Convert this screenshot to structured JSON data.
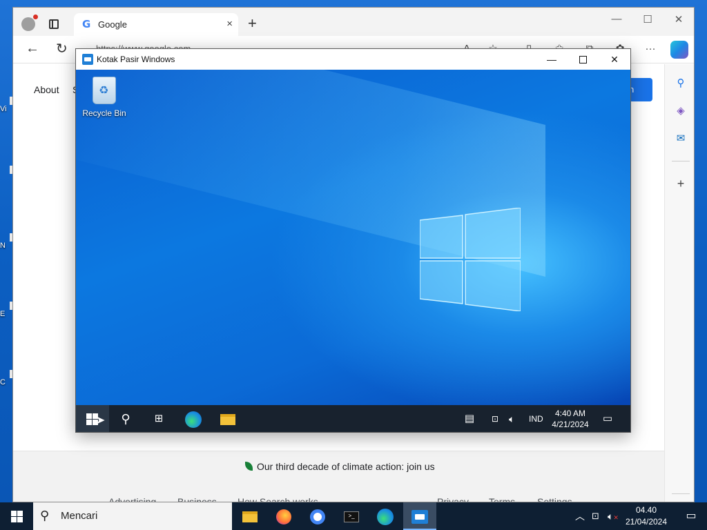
{
  "browser": {
    "tab": {
      "title": "Google",
      "close": "×"
    },
    "new_tab": "+",
    "window_controls": {
      "minimize": "—",
      "maximize": "☐",
      "close": "✕"
    },
    "url": "https://www.google.com",
    "icons": [
      "back-icon",
      "reload-icon",
      "read-aloud-icon",
      "favorite-star-icon",
      "split-screen-icon",
      "favorites-icon",
      "collections-icon",
      "extensions-icon",
      "more-icon",
      "copilot-icon"
    ],
    "more": "···",
    "sidebar": [
      "search-icon",
      "copilot-icon",
      "outlook-icon",
      "add-icon",
      "settings-icon"
    ]
  },
  "google_page": {
    "about": "About",
    "store_partial": "S",
    "sign_in_partial": "n",
    "climate": "Our third decade of climate action: join us",
    "footer_links": [
      "Advertising",
      "Business",
      "How Search works",
      "Privacy",
      "Terms",
      "Settings"
    ]
  },
  "sandbox": {
    "title": "Kotak Pasir Windows",
    "controls": {
      "minimize": "—",
      "close": "✕"
    },
    "recycle_bin": "Recycle Bin",
    "taskbar": {
      "lang": "IND",
      "time": "4:40 AM",
      "date": "4/21/2024"
    }
  },
  "host_desktop": {
    "icon_labels": [
      "Vi",
      "N",
      "E",
      "C"
    ]
  },
  "host_taskbar": {
    "search_placeholder": "Mencari",
    "time": "04.40",
    "date": "21/04/2024",
    "apps": [
      "file-explorer",
      "firefox",
      "chrome",
      "terminal",
      "edge",
      "windows-sandbox"
    ],
    "accent": "#0e1f33"
  }
}
